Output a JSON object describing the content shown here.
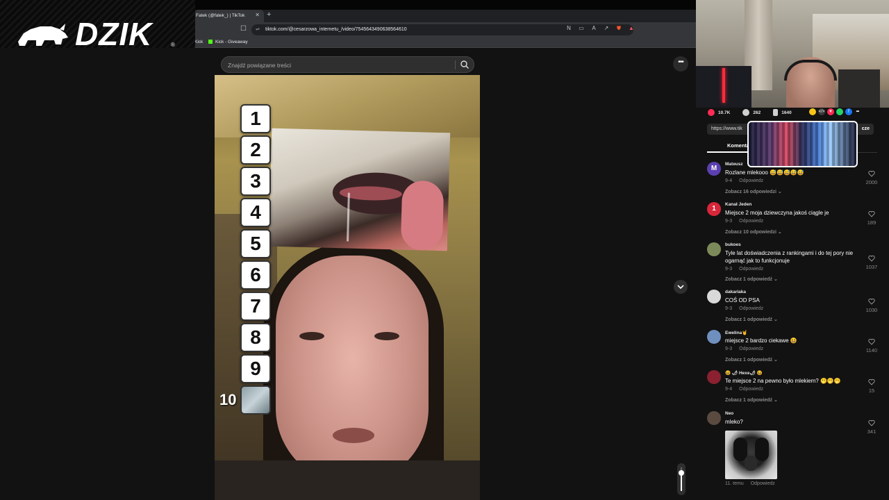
{
  "browser": {
    "tab_title": "Fatek (@fatek_) | TikTok",
    "url": "tiktok.com/@cesarzowa_internetu_/video/7545643490638564610",
    "bookmarks": [
      "Kick",
      "Kick - Giveaway"
    ]
  },
  "logo": {
    "text": "DZIK",
    "reg": "®"
  },
  "tiktok": {
    "search_placeholder": "Znajdź powiązane treści",
    "more_label": "•••"
  },
  "video": {
    "ranks": [
      "1",
      "2",
      "3",
      "4",
      "5",
      "6",
      "7",
      "8",
      "9"
    ],
    "rank_ten": "10"
  },
  "side": {
    "stats": {
      "likes": "10.7K",
      "comments": "262",
      "saves": "1640"
    },
    "url": "https://www.tik",
    "copy_label": "cze",
    "tab_comments": "Komentarze"
  },
  "comments": [
    {
      "author": "Mateusz",
      "text": "Rozlane mlekooo 😅😅😅😅😅",
      "date": "9-4",
      "reply": "Odpowiedz",
      "more": "Zobacz 16 odpowiedzi ⌄",
      "likes": "2000",
      "avatar": "M",
      "avatar_color": "#5b3fb0"
    },
    {
      "author": "Kanał Jeden",
      "text": "Miejsce 2 moja dziewczyna jakoś ciągle je",
      "date": "9-3",
      "reply": "Odpowiedz",
      "more": "Zobacz 10 odpowiedzi ⌄",
      "likes": "189",
      "avatar": "1",
      "avatar_color": "#d8263a"
    },
    {
      "author": "bukoes",
      "text": "Tyle lat doświadczenia z rankingami i do tej pory nie ogarnąć jak to funkcjonuje",
      "date": "9-3",
      "reply": "Odpowiedz",
      "more": "Zobacz 1 odpowiedź ⌄",
      "likes": "1037",
      "avatar": "",
      "avatar_color": "#7c8a5a"
    },
    {
      "author": "dakariaka",
      "text": "COŚ OD PSA",
      "date": "9-3",
      "reply": "Odpowiedz",
      "more": "Zobacz 1 odpowiedź ⌄",
      "likes": "1030",
      "avatar": "",
      "avatar_color": "#d9d9d9"
    },
    {
      "author": "Ewelina🤘",
      "text": "miejsce 2 bardzo ciekawe 😆",
      "date": "9-3",
      "reply": "Odpowiedz",
      "more": "Zobacz 1 odpowiedź ⌄",
      "likes": "1140",
      "avatar": "",
      "avatar_color": "#6f8fbf"
    },
    {
      "author": "😆 🌶 Hexe🌶 😆",
      "text": "Te miejsce 2 na pewno było mlekiem? 🫢🫢🫢",
      "date": "9-4",
      "reply": "Odpowiedz",
      "more": "Zobacz 1 odpowiedź ⌄",
      "likes": "15",
      "avatar": "",
      "avatar_color": "#8a2030"
    },
    {
      "author": "Neo",
      "text": "mleko?",
      "date": "11. temu",
      "reply": "Odpowiedz",
      "more": "",
      "likes": "341",
      "avatar": "",
      "avatar_color": "#5a4a40"
    }
  ]
}
